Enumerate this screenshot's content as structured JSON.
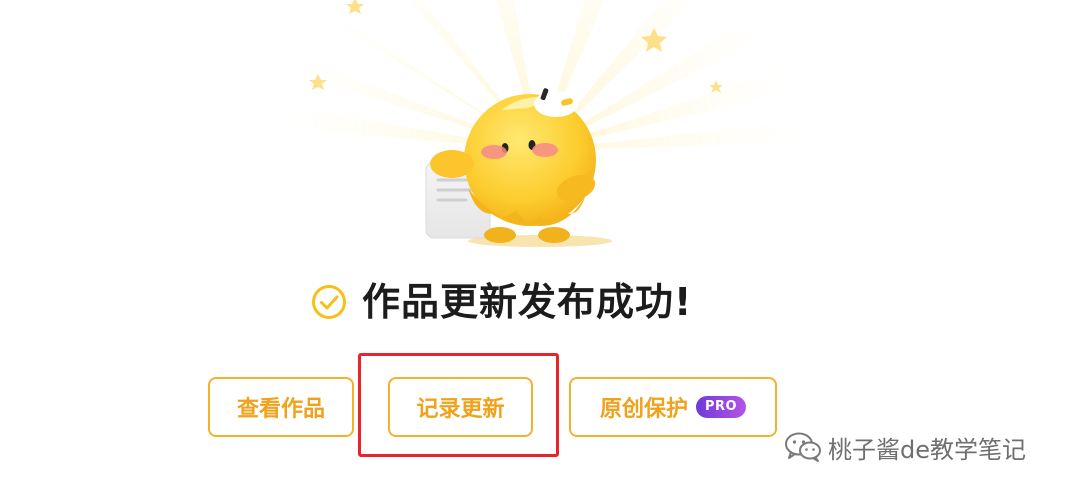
{
  "success": {
    "title": "作品更新发布成功!"
  },
  "buttons": {
    "view": "查看作品",
    "record": "记录更新",
    "protect": "原创保护",
    "pro_badge": "PRO"
  },
  "watermark": {
    "text": "桃子酱de教学笔记"
  },
  "colors": {
    "accent": "#f5b12a",
    "accent_text": "#f0a21c",
    "highlight": "#e8252a",
    "badge_start": "#6f3bd6",
    "badge_end": "#b453e6",
    "title": "#1c1c1c"
  },
  "icons": {
    "success": "check-circle-icon",
    "watermark": "wechat-icon",
    "mascot": "mascot-illustration"
  }
}
